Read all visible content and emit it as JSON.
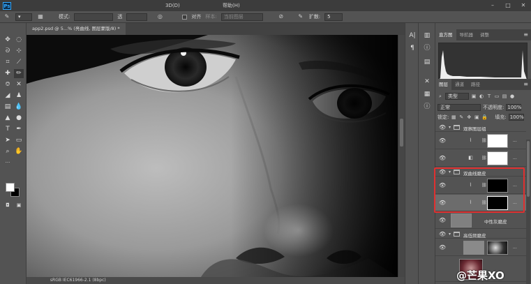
{
  "app": {
    "logo": "Ps",
    "menus": [
      "",
      "",
      "",
      "",
      "",
      "",
      "",
      "",
      "",
      "",
      "3D(D)",
      "",
      "",
      "",
      "",
      "帮助(H)"
    ],
    "window_controls": [
      "–",
      "□",
      "✕"
    ]
  },
  "options": {
    "mode_label": "模式:",
    "mode_value": "",
    "opacity_label": "透",
    "align_label": "对齐",
    "sample_label": "样本:",
    "sample_value": "当前图层",
    "diffusion_label": "扩散:",
    "diffusion_value": "5"
  },
  "document": {
    "tab_title": "app2.psd @ 5...% (亮曲线, 图层蒙版/8) *",
    "status_zoom": "",
    "status_profile": "sRGB IEC61966-2.1 (8bpc)"
  },
  "panels": {
    "top_tabs": [
      "直方图",
      "导航器",
      "调整"
    ],
    "layer_tabs": [
      "图层",
      "通道",
      "路径"
    ],
    "kind_filter": "类型",
    "blend_mode": "正常",
    "opacity_label": "不透明度:",
    "opacity_value": "100%",
    "lock_label": "锁定:",
    "fill_label": "填充:",
    "fill_value": "100%",
    "dots": "..."
  },
  "layers": [
    {
      "name": "观察图层组"
    },
    {
      "name": ""
    },
    {
      "name": ""
    },
    {
      "name": "双曲线磨皮"
    },
    {
      "name": ""
    },
    {
      "name": ""
    },
    {
      "name": "中性灰磨皮"
    },
    {
      "name": "高低频磨皮"
    },
    {
      "name": ""
    },
    {
      "name": ""
    }
  ],
  "watermark": "@芒果XO"
}
